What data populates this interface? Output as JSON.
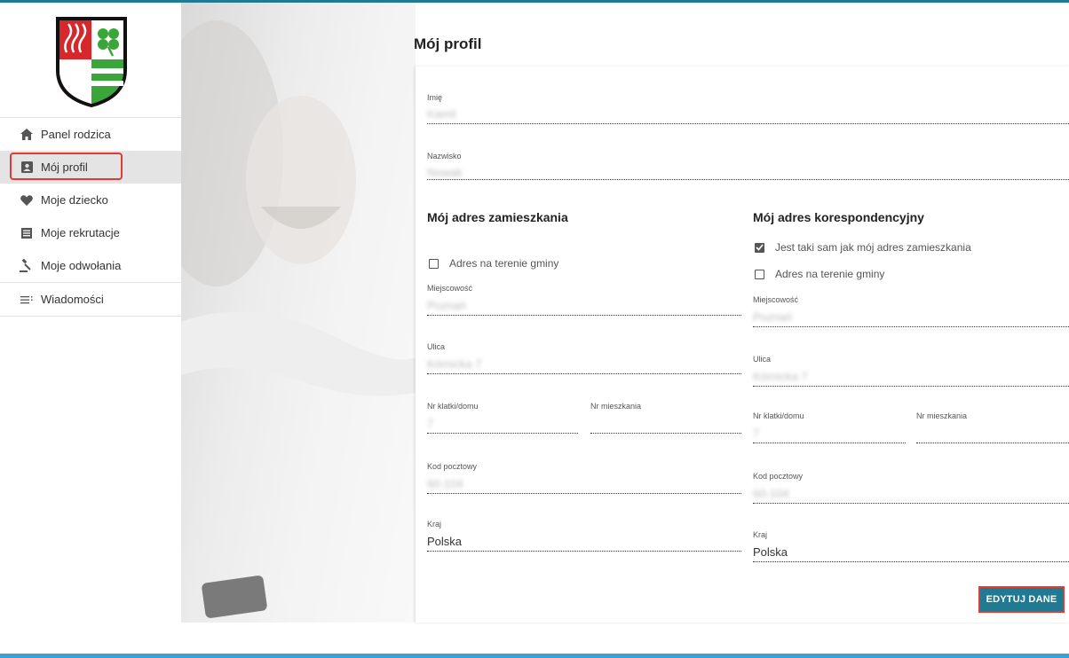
{
  "sidebar": {
    "items": [
      {
        "label": "Panel rodzica",
        "icon": "home-icon"
      },
      {
        "label": "Mój profil",
        "icon": "profile-card-icon",
        "active": true
      },
      {
        "label": "Moje dziecko",
        "icon": "heart-icon"
      },
      {
        "label": "Moje rekrutacje",
        "icon": "list-icon"
      },
      {
        "label": "Moje odwołania",
        "icon": "gavel-icon"
      },
      {
        "label": "Wiadomości",
        "icon": "messages-icon"
      }
    ]
  },
  "page": {
    "title": "Mój profil"
  },
  "profile": {
    "first_name": {
      "label": "Imię",
      "value": "Kamil"
    },
    "last_name": {
      "label": "Nazwisko",
      "value": "Nowak"
    }
  },
  "residence": {
    "title": "Mój adres zamieszkania",
    "in_commune": {
      "label": "Adres na terenie gminy",
      "checked": false
    },
    "city": {
      "label": "Miejscowość",
      "value": "Poznań"
    },
    "street": {
      "label": "Ulica",
      "value": "Kórnicka 7"
    },
    "building": {
      "label": "Nr klatki/domu",
      "value": "7"
    },
    "apartment": {
      "label": "Nr mieszkania",
      "value": ""
    },
    "postal_code": {
      "label": "Kod pocztowy",
      "value": "60-104"
    },
    "country": {
      "label": "Kraj",
      "value": "Polska"
    }
  },
  "correspondence": {
    "title": "Mój adres korespondencyjny",
    "same_as_residence": {
      "label": "Jest taki sam jak mój adres zamieszkania",
      "checked": true
    },
    "in_commune": {
      "label": "Adres na terenie gminy",
      "checked": false
    },
    "city": {
      "label": "Miejscowość",
      "value": "Poznań"
    },
    "street": {
      "label": "Ulica",
      "value": "Kórnicka 7"
    },
    "building": {
      "label": "Nr klatki/domu",
      "value": "7"
    },
    "apartment": {
      "label": "Nr mieszkania",
      "value": ""
    },
    "postal_code": {
      "label": "Kod pocztowy",
      "value": "60-104"
    },
    "country": {
      "label": "Kraj",
      "value": "Polska"
    }
  },
  "actions": {
    "edit_label": "EDYTUJ DANE"
  },
  "colors": {
    "accent": "#1f7a92",
    "highlight": "#e53935",
    "bottom_bar": "#39a2cf"
  }
}
